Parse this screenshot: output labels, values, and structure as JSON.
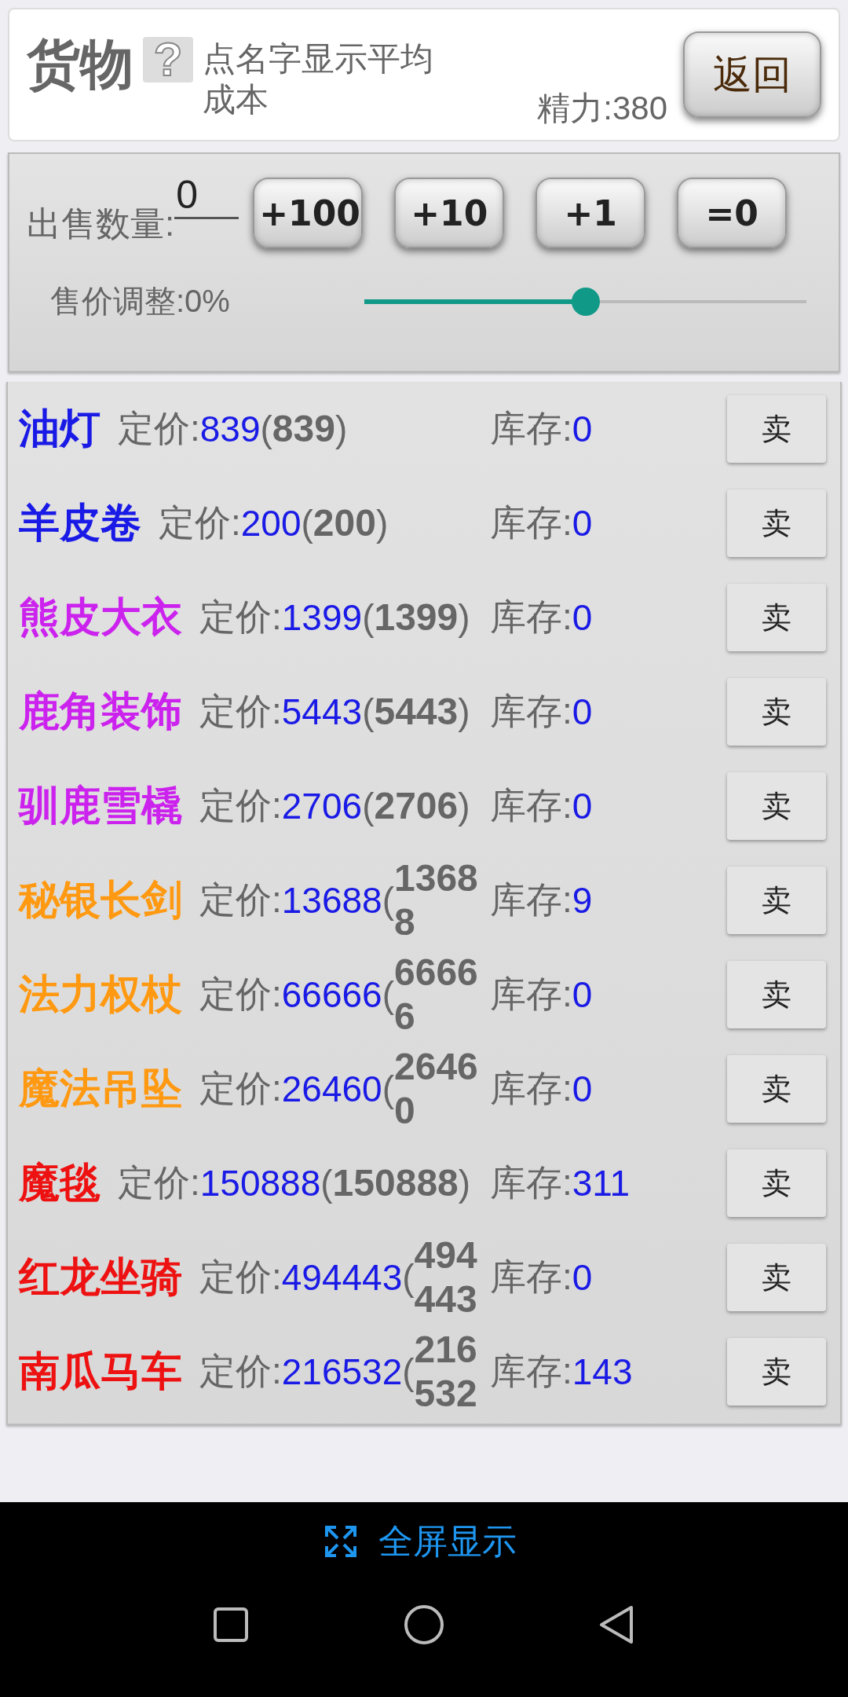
{
  "header": {
    "title": "货物",
    "help": "?",
    "hint": "点名字显示平均成本",
    "energy": "精力:380",
    "back_button": "返回"
  },
  "sell_panel": {
    "quantity_label": "出售数量:",
    "quantity_value": "0",
    "buttons": [
      "+100",
      "+10",
      "+1",
      "=0"
    ],
    "adjust_label": "售价调整:0%",
    "adjust_slider": {
      "level": 0.5
    }
  },
  "items": [
    {
      "name": "油灯",
      "color": "#1a1ae6",
      "price_label": "定价:",
      "price": "839",
      "open": "(",
      "cost": "839",
      "close": ")",
      "stock_label": "库存:",
      "stock": "0",
      "sell": "卖"
    },
    {
      "name": "羊皮卷",
      "color": "#1a1ae6",
      "price_label": "定价:",
      "price": "200",
      "open": "(",
      "cost": "200",
      "close": ")",
      "stock_label": "库存:",
      "stock": "0",
      "sell": "卖"
    },
    {
      "name": "熊皮大衣",
      "color": "#cc22ee",
      "price_label": "定价:",
      "price": "1399",
      "open": "(",
      "cost": "1399",
      "close": ")",
      "stock_label": "库存:",
      "stock": "0",
      "sell": "卖"
    },
    {
      "name": "鹿角装饰",
      "color": "#cc22ee",
      "price_label": "定价:",
      "price": "5443",
      "open": "(",
      "cost": "5443",
      "close": ")",
      "stock_label": "库存:",
      "stock": "0",
      "sell": "卖"
    },
    {
      "name": "驯鹿雪橇",
      "color": "#cc22ee",
      "price_label": "定价:",
      "price": "2706",
      "open": "(",
      "cost": "2706",
      "close": ")",
      "stock_label": "库存:",
      "stock": "0",
      "sell": "卖"
    },
    {
      "name": "秘银长剑",
      "color": "#ff9911",
      "price_label": "定价:",
      "price": "13688",
      "open": "(",
      "cost": "13688",
      "stock_label": "库存:",
      "stock": "9",
      "sell": "卖"
    },
    {
      "name": "法力权杖",
      "color": "#ff9911",
      "price_label": "定价:",
      "price": "66666",
      "open": "(",
      "cost": "66666",
      "stock_label": "库存:",
      "stock": "0",
      "sell": "卖"
    },
    {
      "name": "魔法吊坠",
      "color": "#ff9911",
      "price_label": "定价:",
      "price": "26460",
      "open": "(",
      "cost": "26460",
      "stock_label": "库存:",
      "stock": "0",
      "sell": "卖"
    },
    {
      "name": "魔毯",
      "color": "#ee1111",
      "price_label": "定价:",
      "price": "150888",
      "open": "(",
      "cost": "150888",
      "close": ")",
      "stock_label": "库存:",
      "stock": "311",
      "sell": "卖"
    },
    {
      "name": "红龙坐骑",
      "color": "#ee1111",
      "price_label": "定价:",
      "price": "494443",
      "open": "(",
      "cost": "494443",
      "stock_label": "库存:",
      "stock": "0",
      "sell": "卖"
    },
    {
      "name": "南瓜马车",
      "color": "#ee1111",
      "price_label": "定价:",
      "price": "216532",
      "open": "(",
      "cost": "216532",
      "stock_label": "库存:",
      "stock": "143",
      "sell": "卖"
    }
  ],
  "fullscreen": "全屏显示"
}
